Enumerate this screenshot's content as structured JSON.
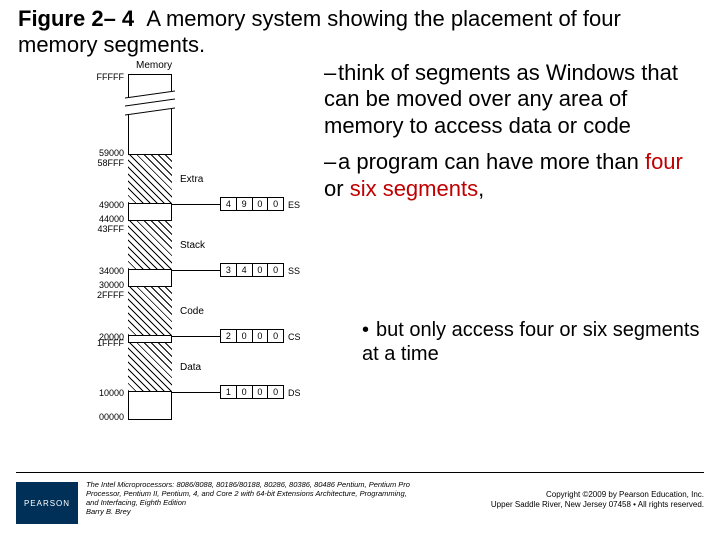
{
  "figure": {
    "number": "Figure 2– 4",
    "caption": "A memory system showing the placement of four memory segments."
  },
  "diagram": {
    "memory_label": "Memory",
    "top_addr": "FFFFF",
    "bottom_addr": "00000",
    "segments": [
      {
        "name": "Extra",
        "top": "59000",
        "top2": "58FFF",
        "bottom": "49000",
        "reg": [
          "4",
          "9",
          "0",
          "0"
        ],
        "reg_name": "ES"
      },
      {
        "name": "Stack",
        "top": "44000",
        "top2": "43FFF",
        "bottom": "34000",
        "reg": [
          "3",
          "4",
          "0",
          "0"
        ],
        "reg_name": "SS"
      },
      {
        "name": "Code",
        "top": "30000",
        "top2": "2FFFF",
        "bottom": "20000",
        "reg": [
          "2",
          "0",
          "0",
          "0"
        ],
        "reg_name": "CS"
      },
      {
        "name": "Data",
        "top": "1FFFF",
        "top2": "",
        "bottom": "10000",
        "reg": [
          "1",
          "0",
          "0",
          "0"
        ],
        "reg_name": "DS"
      }
    ]
  },
  "bullets": {
    "b1": "think of segments as Windows that can be moved over any area of memory to access data or code",
    "b2a": "a program can have more than ",
    "b2_four": "four",
    "b2_or": " or ",
    "b2_six": "six segments",
    "b2_comma": ",",
    "sub": "but only access four or six segments at a time"
  },
  "footer": {
    "logo": "PEARSON",
    "book": "The Intel Microprocessors: 8086/8088, 80186/80188, 80286, 80386, 80486 Pentium, Pentium Pro Processor, Pentium II, Pentium, 4, and Core 2 with 64-bit Extensions Architecture, Programming, and Interfacing, Eighth Edition",
    "author": "Barry B. Brey",
    "copyright1": "Copyright ©2009 by Pearson Education, Inc.",
    "copyright2": "Upper Saddle River, New Jersey 07458 • All rights reserved."
  }
}
